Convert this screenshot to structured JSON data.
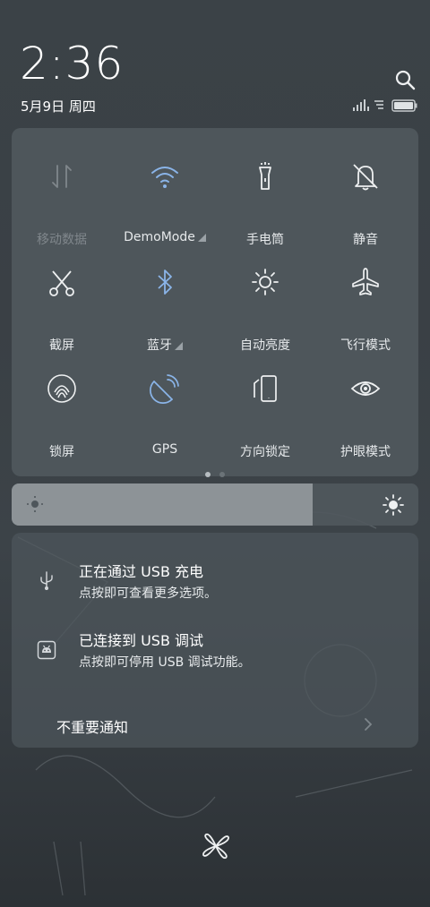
{
  "statusbar": {
    "time": "2:36",
    "date": "5月9日 周四"
  },
  "tiles": [
    {
      "label": "移动数据",
      "icon": "mobile-data-icon",
      "active": false,
      "more": false
    },
    {
      "label": "DemoMode",
      "icon": "wifi-icon",
      "active": true,
      "more": true
    },
    {
      "label": "手电筒",
      "icon": "flashlight-icon",
      "active": false,
      "more": false
    },
    {
      "label": "静音",
      "icon": "mute-icon",
      "active": false,
      "more": false
    },
    {
      "label": "截屏",
      "icon": "screenshot-icon",
      "active": false,
      "more": false
    },
    {
      "label": "蓝牙",
      "icon": "bluetooth-icon",
      "active": true,
      "more": true
    },
    {
      "label": "自动亮度",
      "icon": "auto-brightness-icon",
      "active": false,
      "more": false
    },
    {
      "label": "飞行模式",
      "icon": "airplane-icon",
      "active": false,
      "more": false
    },
    {
      "label": "锁屏",
      "icon": "lock-screen-icon",
      "active": false,
      "more": false
    },
    {
      "label": "GPS",
      "icon": "gps-icon",
      "active": true,
      "more": false
    },
    {
      "label": "方向锁定",
      "icon": "rotation-lock-icon",
      "active": false,
      "more": false
    },
    {
      "label": "护眼模式",
      "icon": "eye-care-icon",
      "active": false,
      "more": false
    }
  ],
  "pager": {
    "current": 1,
    "total": 2
  },
  "brightness": {
    "level": 0.74
  },
  "notifications": [
    {
      "title": "正在通过 USB 充电",
      "subtitle": "点按即可查看更多选项。",
      "icon": "usb-charging-icon"
    },
    {
      "title": "已连接到 USB 调试",
      "subtitle": "点按即可停用 USB 调试功能。",
      "icon": "android-debug-icon"
    }
  ],
  "unimportant_label": "不重要通知",
  "colors": {
    "accent": "#8ab4e8",
    "icon": "#eef0f1",
    "dim": "#80878c"
  }
}
